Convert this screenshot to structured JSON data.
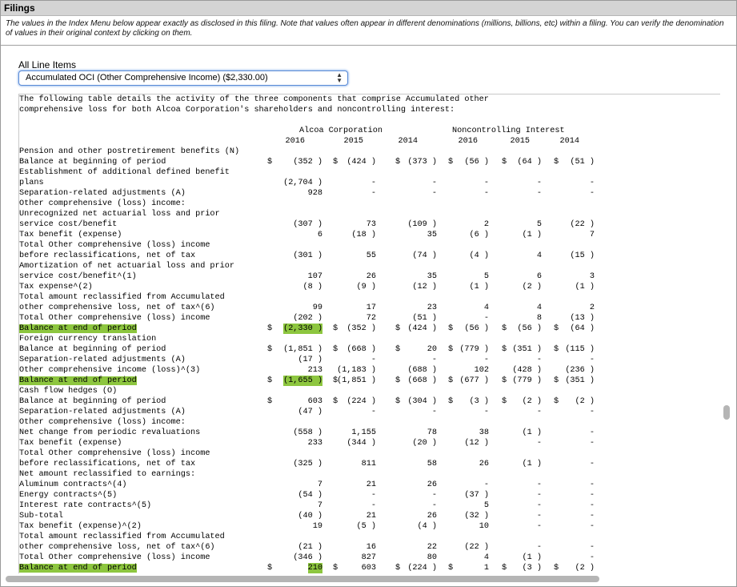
{
  "header": {
    "title": "Filings"
  },
  "note": "The values in the Index Menu below appear exactly as disclosed in this filing. Note that values often appear in different denominations (millions, billions, etc) within a filing. You can verify the denomination of values in their original context by clicking on them.",
  "menu": {
    "label": "All Line Items",
    "selected": "Accumulated OCI (Other Comprehensive Income) ($2,330.00)"
  },
  "intro": [
    "The following table details the activity of the three components that comprise Accumulated other",
    "comprehensive loss for both Alcoa Corporation's shareholders and noncontrolling interest:"
  ],
  "groups": {
    "alcoa": "Alcoa Corporation",
    "nci": "Noncontrolling Interest"
  },
  "years": [
    "2016",
    "2015",
    "2014",
    "2016",
    "2015",
    "2014"
  ],
  "rows": [
    {
      "label": "Pension and other postretirement benefits (N)",
      "cells": [
        "",
        "",
        "",
        "",
        "",
        ""
      ]
    },
    {
      "label": "Balance at beginning of period",
      "cells": [
        "(352 )",
        "(424 )",
        "(373 )",
        "(56 )",
        "(64 )",
        "(51 )"
      ],
      "dollars": [
        true,
        true,
        true,
        true,
        true,
        true
      ]
    },
    {
      "label": "Establishment of additional defined benefit",
      "cells": [
        "",
        "",
        "",
        "",
        "",
        ""
      ]
    },
    {
      "label": "plans",
      "cells": [
        "(2,704 )",
        "-",
        "-",
        "-",
        "-",
        "-"
      ]
    },
    {
      "label": "Separation-related adjustments (A)",
      "cells": [
        "928",
        "-",
        "-",
        "-",
        "-",
        "-"
      ]
    },
    {
      "label": "Other comprehensive (loss) income:",
      "cells": [
        "",
        "",
        "",
        "",
        "",
        ""
      ]
    },
    {
      "label": "Unrecognized net actuarial loss and prior",
      "cells": [
        "",
        "",
        "",
        "",
        "",
        ""
      ]
    },
    {
      "label": "service cost/benefit",
      "cells": [
        "(307 )",
        "73",
        "(109 )",
        "2",
        "5",
        "(22 )"
      ]
    },
    {
      "label": "Tax benefit (expense)",
      "cells": [
        "6",
        "(18 )",
        "35",
        "(6 )",
        "(1 )",
        "7"
      ]
    },
    {
      "label": "Total Other comprehensive (loss) income",
      "cells": [
        "",
        "",
        "",
        "",
        "",
        ""
      ]
    },
    {
      "label": "before reclassifications, net of tax",
      "cells": [
        "(301 )",
        "55",
        "(74 )",
        "(4 )",
        "4",
        "(15 )"
      ]
    },
    {
      "label": "Amortization of net actuarial loss and prior",
      "cells": [
        "",
        "",
        "",
        "",
        "",
        ""
      ]
    },
    {
      "label": "service cost/benefit^(1)",
      "cells": [
        "107",
        "26",
        "35",
        "5",
        "6",
        "3"
      ]
    },
    {
      "label": "Tax expense^(2)",
      "cells": [
        "(8 )",
        "(9 )",
        "(12 )",
        "(1 )",
        "(2 )",
        "(1 )"
      ]
    },
    {
      "label": "Total amount reclassified from Accumulated",
      "cells": [
        "",
        "",
        "",
        "",
        "",
        ""
      ]
    },
    {
      "label": "other comprehensive loss, net of tax^(6)",
      "cells": [
        "99",
        "17",
        "23",
        "4",
        "4",
        "2"
      ]
    },
    {
      "label": "Total Other comprehensive (loss) income",
      "cells": [
        "(202 )",
        "72",
        "(51 )",
        "-",
        "8",
        "(13 )"
      ]
    },
    {
      "label": "Balance at end of period",
      "cells": [
        "(2,330 )",
        "(352 )",
        "(424 )",
        "(56 )",
        "(56 )",
        "(64 )"
      ],
      "dollars": [
        true,
        true,
        true,
        true,
        true,
        true
      ],
      "highlight": true
    },
    {
      "label": "Foreign currency translation",
      "cells": [
        "",
        "",
        "",
        "",
        "",
        ""
      ]
    },
    {
      "label": "Balance at beginning of period",
      "cells": [
        "(1,851 )",
        "(668 )",
        "20",
        "(779 )",
        "(351 )",
        "(115 )"
      ],
      "dollars": [
        true,
        true,
        true,
        true,
        true,
        true
      ]
    },
    {
      "label": "Separation-related adjustments (A)",
      "cells": [
        "(17 )",
        "-",
        "-",
        "-",
        "-",
        "-"
      ]
    },
    {
      "label": "Other comprehensive income (loss)^(3)",
      "cells": [
        "213",
        "(1,183 )",
        "(688 )",
        "102",
        "(428 )",
        "(236 )"
      ]
    },
    {
      "label": "Balance at end of period",
      "cells": [
        "(1,655 )",
        "(1,851 )",
        "(668 )",
        "(677 )",
        "(779 )",
        "(351 )"
      ],
      "dollars": [
        true,
        true,
        true,
        true,
        true,
        true
      ],
      "highlight": true
    },
    {
      "label": "Cash flow hedges (O)",
      "cells": [
        "",
        "",
        "",
        "",
        "",
        ""
      ]
    },
    {
      "label": "Balance at beginning of period",
      "cells": [
        "603",
        "(224 )",
        "(304 )",
        "(3 )",
        "(2 )",
        "(2 )"
      ],
      "dollars": [
        true,
        true,
        true,
        true,
        true,
        true
      ]
    },
    {
      "label": "Separation-related adjustments (A)",
      "cells": [
        "(47 )",
        "-",
        "-",
        "-",
        "-",
        "-"
      ]
    },
    {
      "label": "Other comprehensive (loss) income:",
      "cells": [
        "",
        "",
        "",
        "",
        "",
        ""
      ]
    },
    {
      "label": "Net change from periodic revaluations",
      "cells": [
        "(558 )",
        "1,155",
        "78",
        "38",
        "(1 )",
        "-"
      ]
    },
    {
      "label": "Tax benefit (expense)",
      "cells": [
        "233",
        "(344 )",
        "(20 )",
        "(12 )",
        "-",
        "-"
      ]
    },
    {
      "label": "Total Other comprehensive (loss) income",
      "cells": [
        "",
        "",
        "",
        "",
        "",
        ""
      ]
    },
    {
      "label": "before reclassifications, net of tax",
      "cells": [
        "(325 )",
        "811",
        "58",
        "26",
        "(1 )",
        "-"
      ]
    },
    {
      "label": "Net amount reclassified to earnings:",
      "cells": [
        "",
        "",
        "",
        "",
        "",
        ""
      ]
    },
    {
      "label": "Aluminum contracts^(4)",
      "cells": [
        "7",
        "21",
        "26",
        "-",
        "-",
        "-"
      ]
    },
    {
      "label": "Energy contracts^(5)",
      "cells": [
        "(54 )",
        "-",
        "-",
        "(37 )",
        "-",
        "-"
      ]
    },
    {
      "label": "Interest rate contracts^(5)",
      "cells": [
        "7",
        "-",
        "-",
        "5",
        "-",
        "-"
      ]
    },
    {
      "label": "Sub-total",
      "cells": [
        "(40 )",
        "21",
        "26",
        "(32 )",
        "-",
        "-"
      ]
    },
    {
      "label": "Tax benefit (expense)^(2)",
      "cells": [
        "19",
        "(5 )",
        "(4 )",
        "10",
        "-",
        "-"
      ]
    },
    {
      "label": "Total amount reclassified from Accumulated",
      "cells": [
        "",
        "",
        "",
        "",
        "",
        ""
      ]
    },
    {
      "label": "other comprehensive loss, net of tax^(6)",
      "cells": [
        "(21 )",
        "16",
        "22",
        "(22 )",
        "-",
        "-"
      ]
    },
    {
      "label": "Total Other comprehensive (loss) income",
      "cells": [
        "(346 )",
        "827",
        "80",
        "4",
        "(1 )",
        "-"
      ]
    },
    {
      "label": "Balance at end of period",
      "cells": [
        "210",
        "603",
        "(224 )",
        "1",
        "(3 )",
        "(2 )"
      ],
      "dollars": [
        true,
        true,
        true,
        true,
        true,
        true
      ],
      "highlight": true
    }
  ],
  "dollar_sign": "$"
}
